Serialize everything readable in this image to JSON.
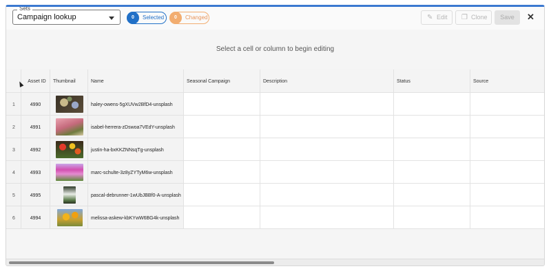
{
  "toolbar": {
    "sets_label": "Sets",
    "sets_value": "Campaign lookup",
    "selected_count": "0",
    "selected_label": "Selected",
    "changed_count": "0",
    "changed_label": "Changed",
    "edit_label": "Edit",
    "clone_label": "Clone",
    "save_label": "Save",
    "close_glyph": "✕"
  },
  "hint": "Select a cell or column to begin editing",
  "grid": {
    "columns": [
      "",
      "Asset ID",
      "Thumbnail",
      "Name",
      "Seasonal Campaign",
      "Description",
      "Status",
      "Source"
    ],
    "rows": [
      {
        "idx": "1",
        "asset_id": "4990",
        "name": "haley-owens-5gXUVw2BfD4-unsplash"
      },
      {
        "idx": "2",
        "asset_id": "4991",
        "name": "isabel-herrera-zDswoa7VEdY-unsplash"
      },
      {
        "idx": "3",
        "asset_id": "4992",
        "name": "justin-ha-bxKKZNNsqTg-unsplash"
      },
      {
        "idx": "4",
        "asset_id": "4993",
        "name": "marc-schulte-3z8yZYTyM6w-unsplash"
      },
      {
        "idx": "5",
        "asset_id": "4995",
        "name": "pascal-debrunner-1wUbJBBf0-A-unsplash"
      },
      {
        "idx": "6",
        "asset_id": "4994",
        "name": "melissa-askew-kbKYwW6BG4k-unsplash"
      }
    ]
  },
  "colors": {
    "accent": "#3a78d0",
    "selected": "#2170c7",
    "changed": "#f2ad70"
  },
  "icons": {
    "edit": "pencil-icon",
    "clone": "copy-icon",
    "close": "close-icon",
    "dropdown": "chevron-down-icon"
  }
}
